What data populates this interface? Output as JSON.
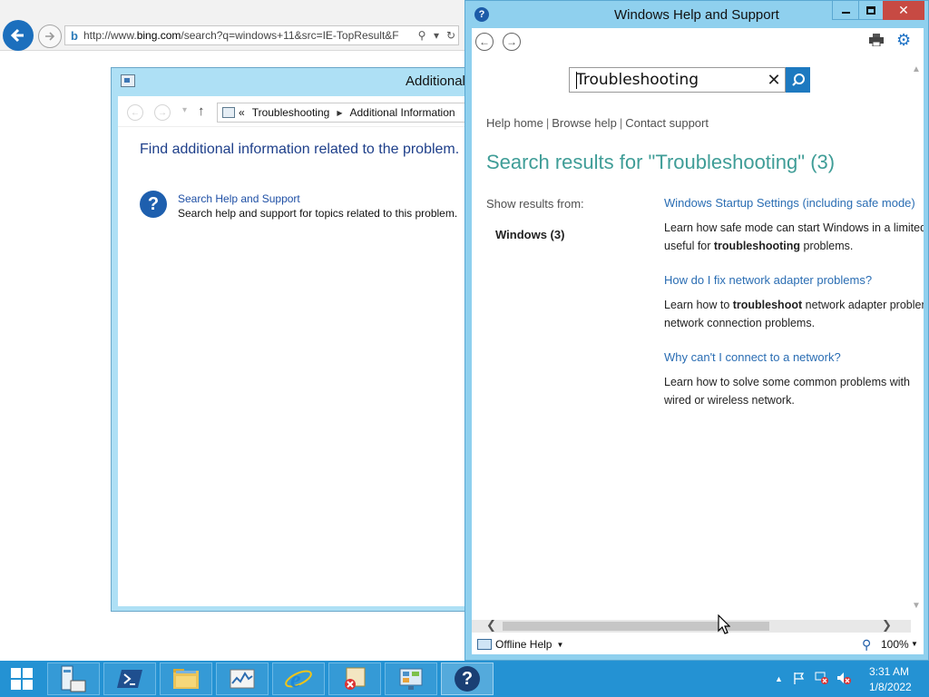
{
  "browser": {
    "url_prefix": "http://www.",
    "url_domain": "bing.com",
    "url_rest": "/search?q=windows+11&src=IE-TopResult&F"
  },
  "additional_window": {
    "title": "Additional",
    "breadcrumb_chevron": "«",
    "breadcrumb": [
      "Troubleshooting",
      "Additional Information"
    ],
    "heading": "Find additional information related to the problem.",
    "link_title": "Search Help and Support",
    "link_desc": "Search help and support for topics related to this problem."
  },
  "help_window": {
    "title": "Windows Help and Support",
    "search_value": "Troubleshooting",
    "links": [
      "Help home",
      "Browse help",
      "Contact support"
    ],
    "results_title": "Search results for \"Troubleshooting\" (3)",
    "show_results_from": "Show results from:",
    "filter": "Windows (3)",
    "results": [
      {
        "title": "Windows Startup Settings (including safe mode)",
        "desc_line1": "Learn how safe mode can start Windows in a limited state",
        "desc_line2_pre": "useful for ",
        "desc_line2_bold": "troubleshooting",
        "desc_line2_post": " problems."
      },
      {
        "title": "How do I fix network adapter problems?",
        "desc_line1_pre": "Learn how to ",
        "desc_line1_bold": "troubleshoot",
        "desc_line1_post": " network adapter problems",
        "desc_line2": "network connection problems."
      },
      {
        "title": "Why can't I connect to a network?",
        "desc_line1": "Learn how to solve some common problems with",
        "desc_line2": "wired or wireless network."
      }
    ],
    "status_offline": "Offline Help",
    "zoom": "100%"
  },
  "taskbar": {
    "time": "3:31 AM",
    "date": "1/8/2022"
  },
  "colors": {
    "taskbar": "#2492d3",
    "help_frame": "#8fd0ee",
    "results_title": "#3f9d97",
    "link": "#2a6db3",
    "close_button": "#c74a43"
  },
  "icons": [
    "back-arrow-icon",
    "forward-arrow-icon",
    "bing-icon",
    "search-icon",
    "refresh-icon",
    "help-icon",
    "print-icon",
    "gear-icon",
    "clear-icon",
    "offline-icon",
    "zoom-icon",
    "start-icon",
    "server-manager-icon",
    "powershell-icon",
    "file-explorer-icon",
    "performance-icon",
    "ie-icon",
    "error-report-icon",
    "control-panel-icon",
    "flag-icon",
    "network-icon",
    "speaker-icon"
  ]
}
